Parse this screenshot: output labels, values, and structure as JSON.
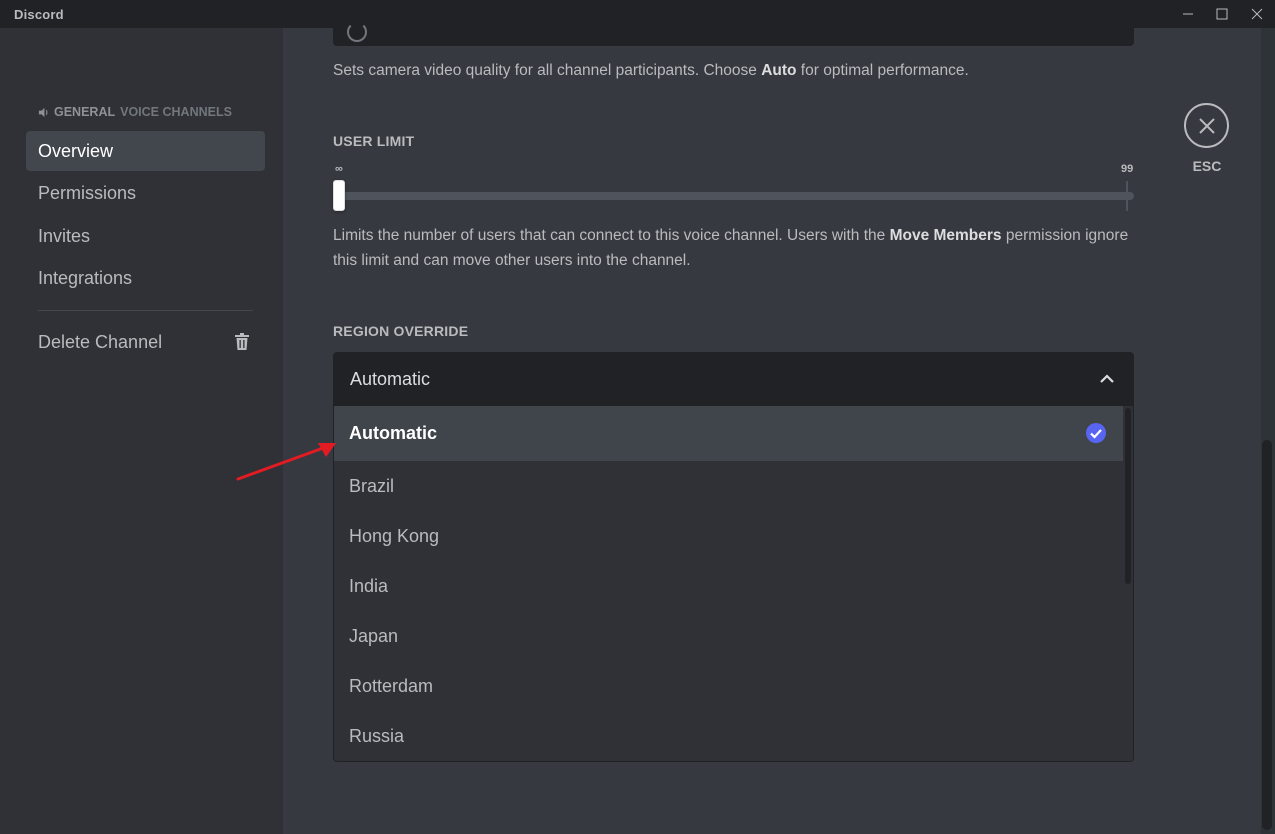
{
  "window": {
    "title": "Discord"
  },
  "sidebar": {
    "header_category": "General",
    "header_sub": "Voice Channels",
    "items": [
      {
        "label": "Overview",
        "active": true
      },
      {
        "label": "Permissions",
        "active": false
      },
      {
        "label": "Invites",
        "active": false
      },
      {
        "label": "Integrations",
        "active": false
      }
    ],
    "delete_label": "Delete Channel"
  },
  "video_quality": {
    "desc_before": "Sets camera video quality for all channel participants. Choose ",
    "desc_bold": "Auto",
    "desc_after": " for optimal performance."
  },
  "user_limit": {
    "label": "User Limit",
    "min_label": "∞",
    "max_label": "99",
    "value": 0,
    "desc_before": "Limits the number of users that can connect to this voice channel. Users with the ",
    "desc_bold": "Move Members",
    "desc_after": " permission ignore this limit and can move other users into the channel."
  },
  "region_override": {
    "label": "Region Override",
    "selected": "Automatic",
    "options": [
      "Automatic",
      "Brazil",
      "Hong Kong",
      "India",
      "Japan",
      "Rotterdam",
      "Russia"
    ]
  },
  "esc": {
    "label": "ESC"
  },
  "colors": {
    "accent": "#5865f2",
    "annotation_arrow": "#e31b23"
  }
}
